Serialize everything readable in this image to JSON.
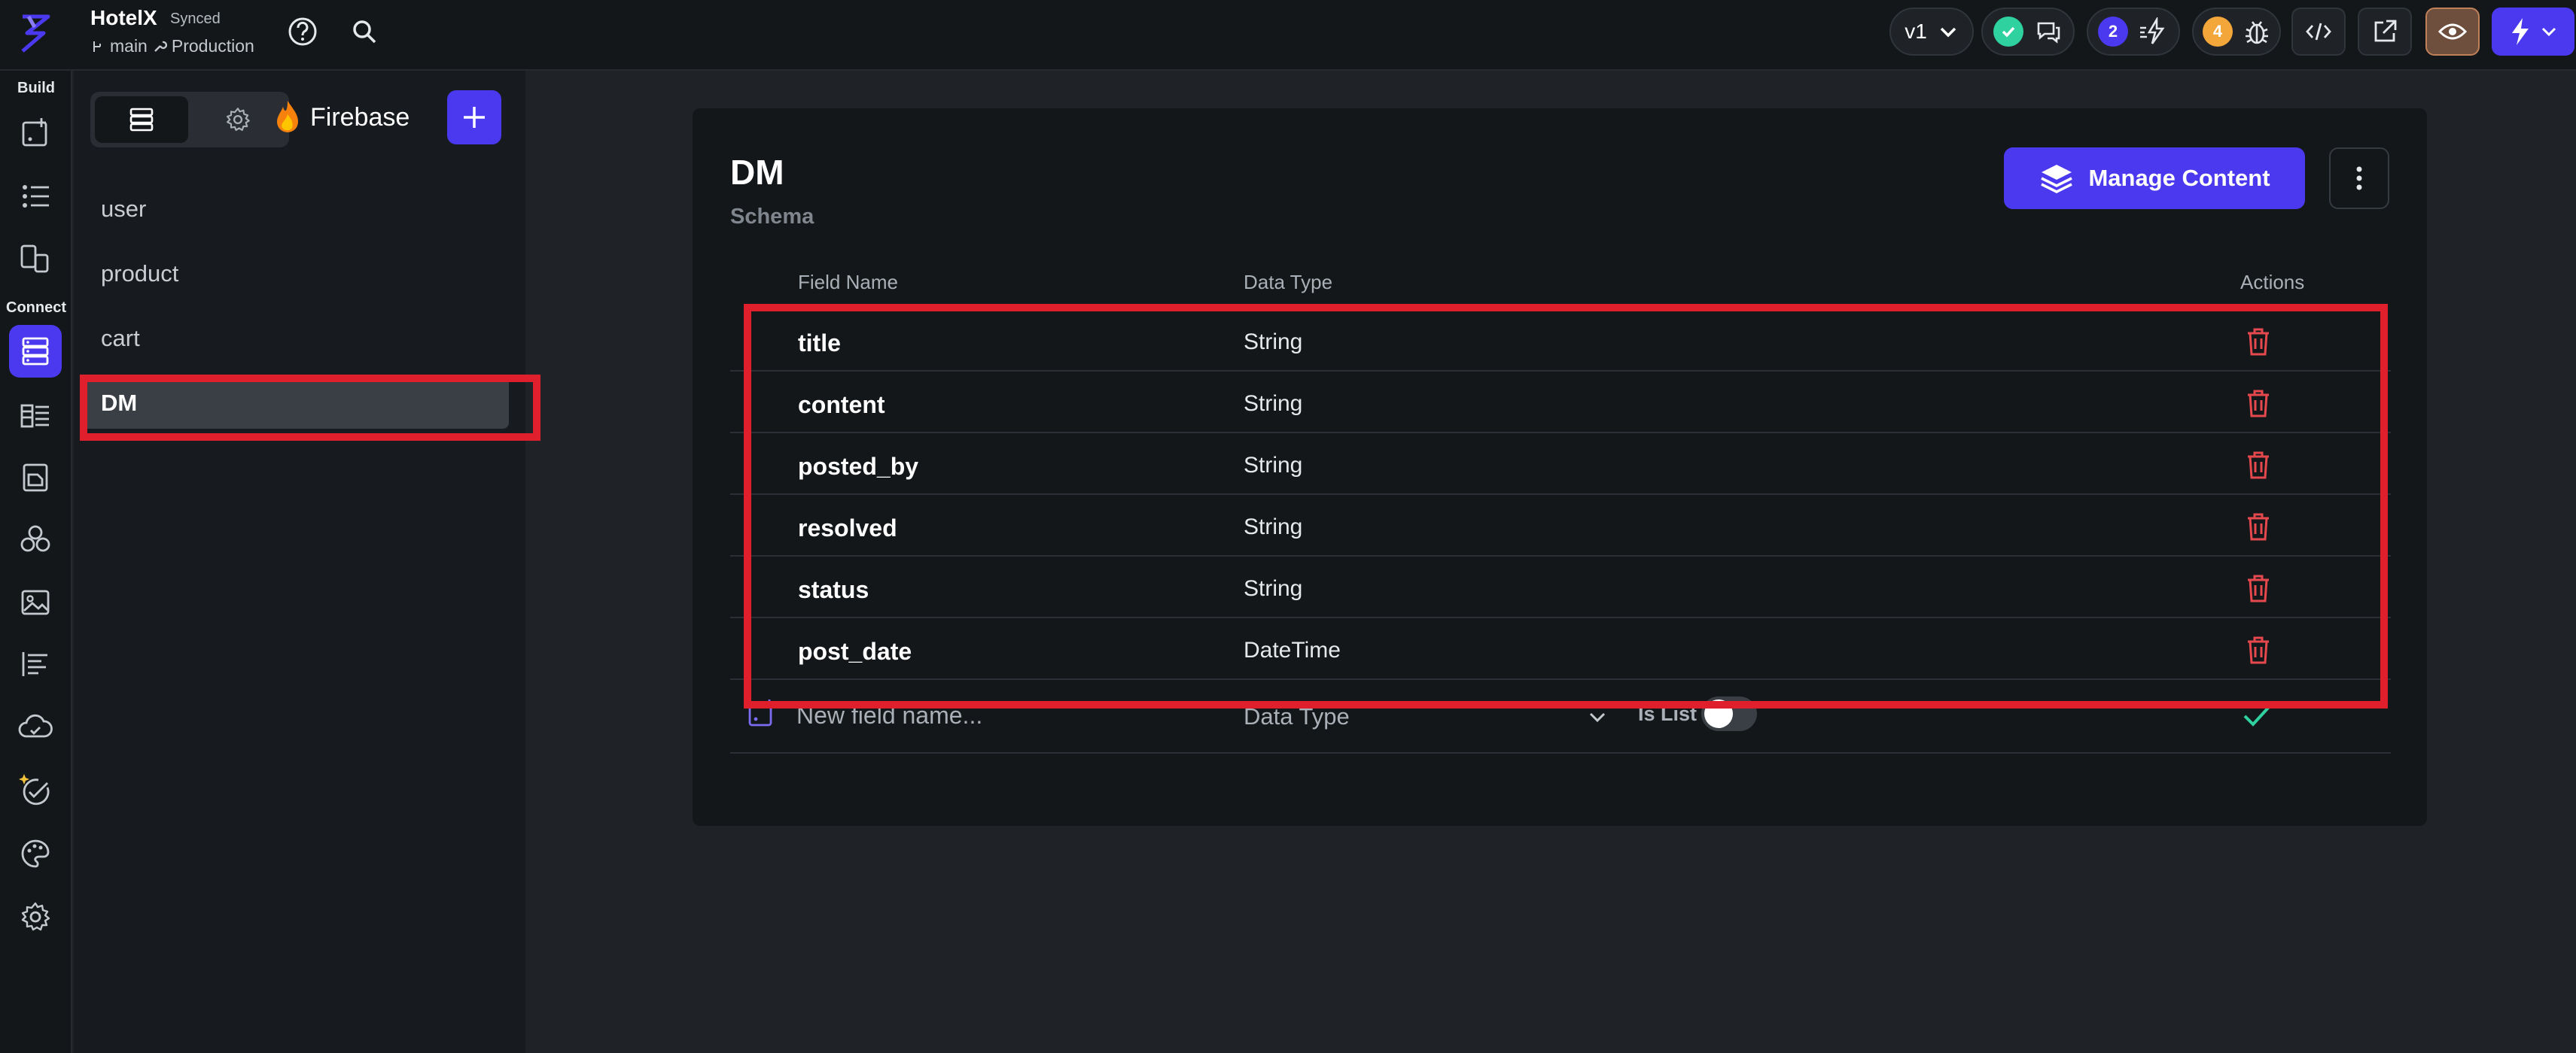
{
  "app": {
    "project_name": "HotelX",
    "sync_status": "Synced",
    "branch": "main",
    "environment": "Production"
  },
  "topbar": {
    "version": "v1",
    "collab_count": "2",
    "issues_count": "4"
  },
  "rail": {
    "build_label": "Build",
    "connect_label": "Connect"
  },
  "panel": {
    "provider": "Firebase",
    "collections": [
      {
        "name": "user"
      },
      {
        "name": "product"
      },
      {
        "name": "cart"
      },
      {
        "name": "DM"
      }
    ]
  },
  "schema": {
    "title": "DM",
    "subtitle": "Schema",
    "manage_label": "Manage Content",
    "headers": {
      "field_name": "Field Name",
      "data_type": "Data Type",
      "actions": "Actions"
    },
    "fields": [
      {
        "name": "title",
        "type": "String"
      },
      {
        "name": "content",
        "type": "String"
      },
      {
        "name": "posted_by",
        "type": "String"
      },
      {
        "name": "resolved",
        "type": "String"
      },
      {
        "name": "status",
        "type": "String"
      },
      {
        "name": "post_date",
        "type": "DateTime"
      }
    ],
    "new_field": {
      "placeholder": "New field name...",
      "data_type_placeholder": "Data Type",
      "is_list_label": "Is List"
    }
  },
  "colors": {
    "accent": "#4b39ef",
    "highlight": "#e01f2d",
    "danger": "#e5484d",
    "success": "#2fd29e"
  }
}
